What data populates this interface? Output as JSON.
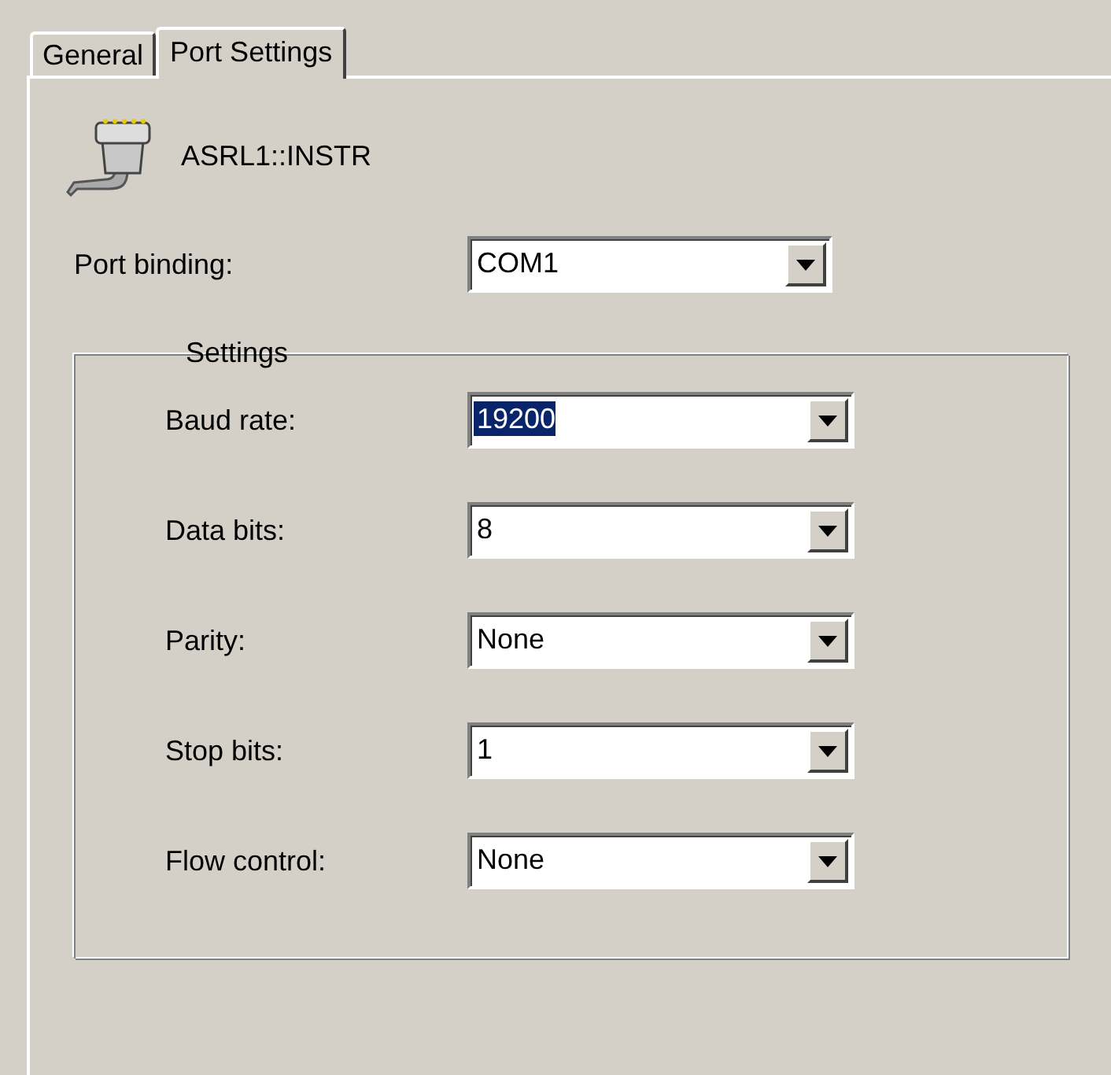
{
  "tabs": [
    {
      "label": "General",
      "selected": false
    },
    {
      "label": "Port Settings",
      "selected": true
    }
  ],
  "resource": {
    "name": "ASRL1::INSTR"
  },
  "port_binding": {
    "label": "Port binding:",
    "value": "COM1",
    "text_selected": false
  },
  "settings": {
    "title": "Settings",
    "fields": [
      {
        "label": "Baud rate:",
        "value": "19200",
        "text_selected": true
      },
      {
        "label": "Data bits:",
        "value": "8",
        "text_selected": false
      },
      {
        "label": "Parity:",
        "value": "None",
        "text_selected": false
      },
      {
        "label": "Stop bits:",
        "value": "1",
        "text_selected": false
      },
      {
        "label": "Flow control:",
        "value": "None",
        "text_selected": false
      }
    ]
  }
}
